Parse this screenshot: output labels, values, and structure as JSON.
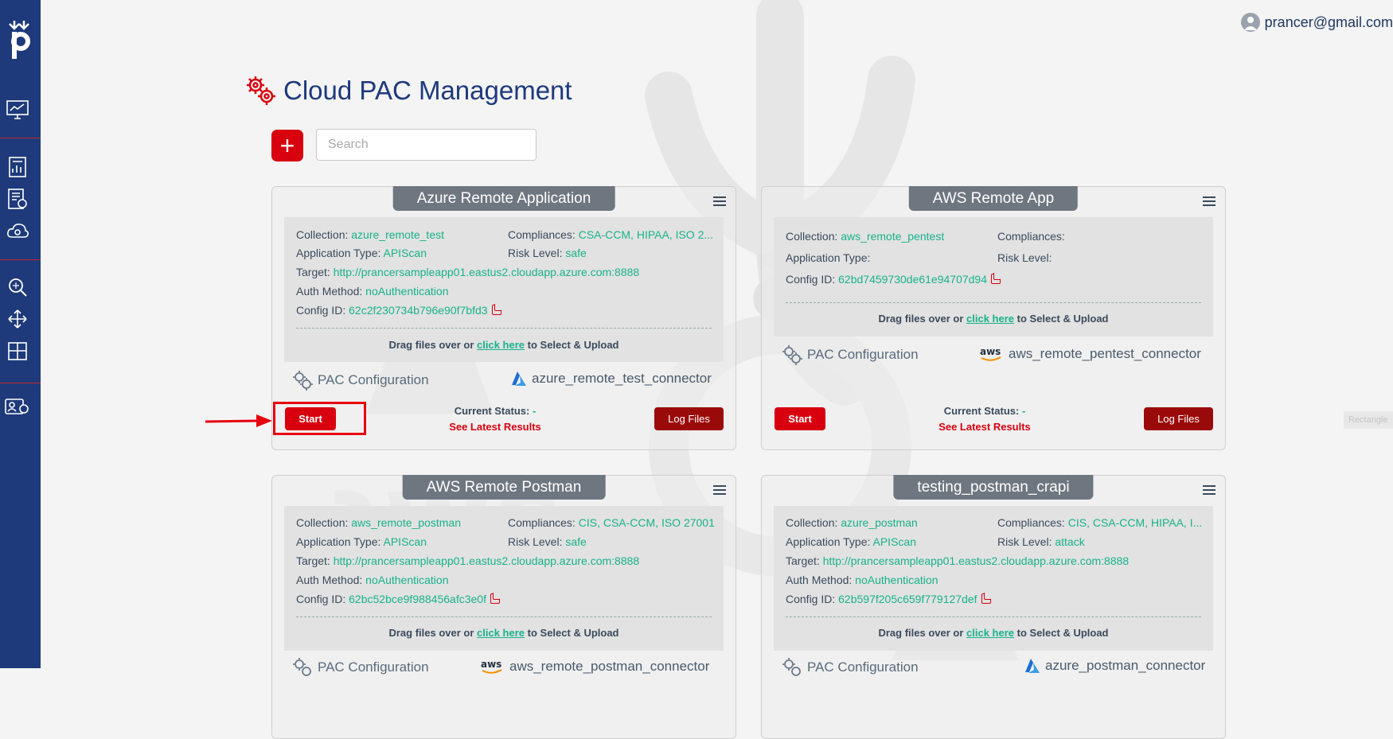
{
  "user": {
    "email": "prancer@gmail.com"
  },
  "page": {
    "title": "Cloud PAC Management"
  },
  "search": {
    "placeholder": "Search"
  },
  "side_tab": "Rectangle",
  "labels": {
    "collection": "Collection:",
    "compliances": "Compliances:",
    "app_type": "Application Type:",
    "risk_level": "Risk Level:",
    "target": "Target:",
    "auth_method": "Auth Method:",
    "config_id": "Config ID:",
    "drag_pre": "Drag files over or ",
    "click_here": "click here",
    "drag_post": " to Select & Upload",
    "pac_config": "PAC Configuration",
    "start": "Start",
    "log_files": "Log Files",
    "current_status": "Current Status:",
    "see_latest": "See Latest Results"
  },
  "cards": [
    {
      "title": "Azure Remote Application",
      "collection": "azure_remote_test",
      "compliances": "CSA-CCM, HIPAA, ISO 2...",
      "app_type": "APIScan",
      "risk_level": "safe",
      "target": "http://prancersampleapp01.eastus2.cloudapp.azure.com:8888",
      "auth_method": "noAuthentication",
      "config_id": "62c2f230734b796e90f7bfd3",
      "connector": "azure_remote_test_connector",
      "connector_icon": "azure-icon",
      "status": "-"
    },
    {
      "title": "AWS Remote App",
      "collection": "aws_remote_pentest",
      "compliances": "",
      "app_type": "",
      "risk_level": "",
      "config_id": "62bd7459730de61e94707d94",
      "connector": "aws_remote_pentest_connector",
      "connector_icon": "aws-icon",
      "status": "-"
    },
    {
      "title": "AWS Remote Postman",
      "collection": "aws_remote_postman",
      "compliances": "CIS, CSA-CCM, ISO 27001",
      "app_type": "APIScan",
      "risk_level": "safe",
      "target": "http://prancersampleapp01.eastus2.cloudapp.azure.com:8888",
      "auth_method": "noAuthentication",
      "config_id": "62bc52bce9f988456afc3e0f",
      "connector": "aws_remote_postman_connector",
      "connector_icon": "aws-icon"
    },
    {
      "title": "testing_postman_crapi",
      "collection": "azure_postman",
      "compliances": "CIS, CSA-CCM, HIPAA, I...",
      "app_type": "APIScan",
      "risk_level": "attack",
      "target": "http://prancersampleapp01.eastus2.cloudapp.azure.com:8888",
      "auth_method": "noAuthentication",
      "config_id": "62b597f205c659f779127def",
      "connector": "azure_postman_connector",
      "connector_icon": "azure-icon"
    }
  ],
  "colors": {
    "sidebar": "#1e3a7b",
    "accent_red": "#d8000f",
    "value_green": "#17b28a",
    "title_blue": "#1e3a7b"
  }
}
